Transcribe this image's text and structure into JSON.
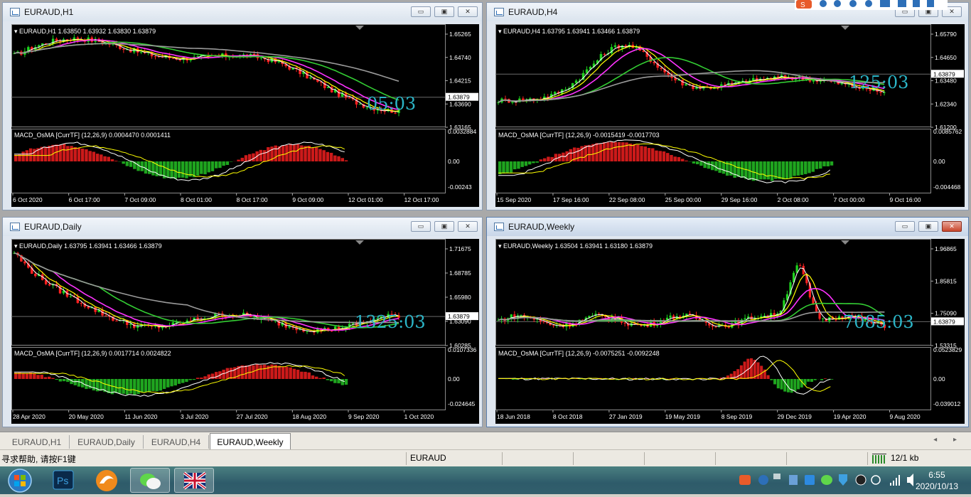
{
  "windows": [
    {
      "title": "EURAUD,H1",
      "info": "EURAUD,H1  1.63850 1.63932 1.63830 1.63879",
      "macd_info": "MACD_OsMA [CurrTF] (12,26,9) 0.0004470 0.0001411",
      "countdown": "05:03",
      "price_levels": [
        "1.65265",
        "1.64740",
        "1.64215",
        "1.63690",
        "1.63165"
      ],
      "current_price": "1.63879",
      "macd_levels": [
        "0.0032884",
        "0.00",
        "-0.00243"
      ],
      "dates": [
        "6 Oct 2020",
        "6 Oct 17:00",
        "7 Oct 09:00",
        "8 Oct 01:00",
        "8 Oct 17:00",
        "9 Oct 09:00",
        "12 Oct 01:00",
        "12 Oct 17:00"
      ]
    },
    {
      "title": "EURAUD,H4",
      "info": "EURAUD,H4  1.63795 1.63941 1.63466 1.63879",
      "macd_info": "MACD_OsMA [CurrTF] (12,26,9) -0.0015419 -0.0017703",
      "countdown": "125:03",
      "price_levels": [
        "1.65790",
        "1.64650",
        "1.63480",
        "1.62340",
        "1.61200"
      ],
      "current_price": "1.63879",
      "macd_levels": [
        "0.0085762",
        "0.00",
        "-0.004468"
      ],
      "dates": [
        "15 Sep 2020",
        "17 Sep 16:00",
        "22 Sep 08:00",
        "25 Sep 00:00",
        "29 Sep 16:00",
        "2 Oct 08:00",
        "7 Oct 00:00",
        "9 Oct 16:00"
      ]
    },
    {
      "title": "EURAUD,Daily",
      "info": "EURAUD,Daily  1.63795 1.63941 1.63466 1.63879",
      "macd_info": "MACD_OsMA [CurrTF] (12,26,9) 0.0017714 0.0024822",
      "countdown": "1325:03",
      "price_levels": [
        "1.71675",
        "1.68785",
        "1.65980",
        "1.63090",
        "1.60285"
      ],
      "current_price": "1.63879",
      "macd_levels": [
        "0.0107336",
        "0.00",
        "-0.024645"
      ],
      "dates": [
        "28 Apr 2020",
        "20 May 2020",
        "11 Jun 2020",
        "3 Jul 2020",
        "27 Jul 2020",
        "18 Aug 2020",
        "9 Sep 2020",
        "1 Oct 2020"
      ]
    },
    {
      "title": "EURAUD,Weekly",
      "info": "EURAUD,Weekly  1.63504 1.63941 1.63180 1.63879",
      "macd_info": "MACD_OsMA [CurrTF] (12,26,9) -0.0075251 -0.0092248",
      "countdown": "7085:03",
      "price_levels": [
        "1.96865",
        "1.85815",
        "1.75090",
        "1.53315"
      ],
      "current_price": "1.63879",
      "macd_levels": [
        "0.0523829",
        "0.00",
        "-0.039012"
      ],
      "dates": [
        "18 Jun 2018",
        "8 Oct 2018",
        "27 Jan 2019",
        "19 May 2019",
        "8 Sep 2019",
        "29 Dec 2019",
        "19 Apr 2020",
        "9 Aug 2020"
      ]
    }
  ],
  "window_buttons": {
    "minimize": "▭",
    "maximize": "▣",
    "close": "✕"
  },
  "tabs": [
    "EURAUD,H1",
    "EURAUD,Daily",
    "EURAUD,H4",
    "EURAUD,Weekly"
  ],
  "active_tab": "EURAUD,Weekly",
  "tab_scroll": "◂ ▸",
  "status": {
    "help": "寻求帮助, 请按F1键",
    "symbol": "EURAUD",
    "traffic": "12/1 kb"
  },
  "clock": {
    "time": "6:55",
    "date": "2020/10/13"
  },
  "taskbar_apps": [
    "start-orb-icon",
    "photoshop-icon",
    "browser-icon",
    "wechat-icon",
    "mt4-uk-flag-icon"
  ],
  "taskbar_labels": {
    "photoshop": "Ps"
  },
  "colors": {
    "bull": "#1ed41e",
    "bear": "#ff2020",
    "ma_fast": "#ffffff",
    "ma_yellow": "#ffff00",
    "ma_magenta": "#ff33ff",
    "ma_green": "#33cc33",
    "ma_gray": "#9a9a9a",
    "countdown": "#2bb5c7"
  }
}
